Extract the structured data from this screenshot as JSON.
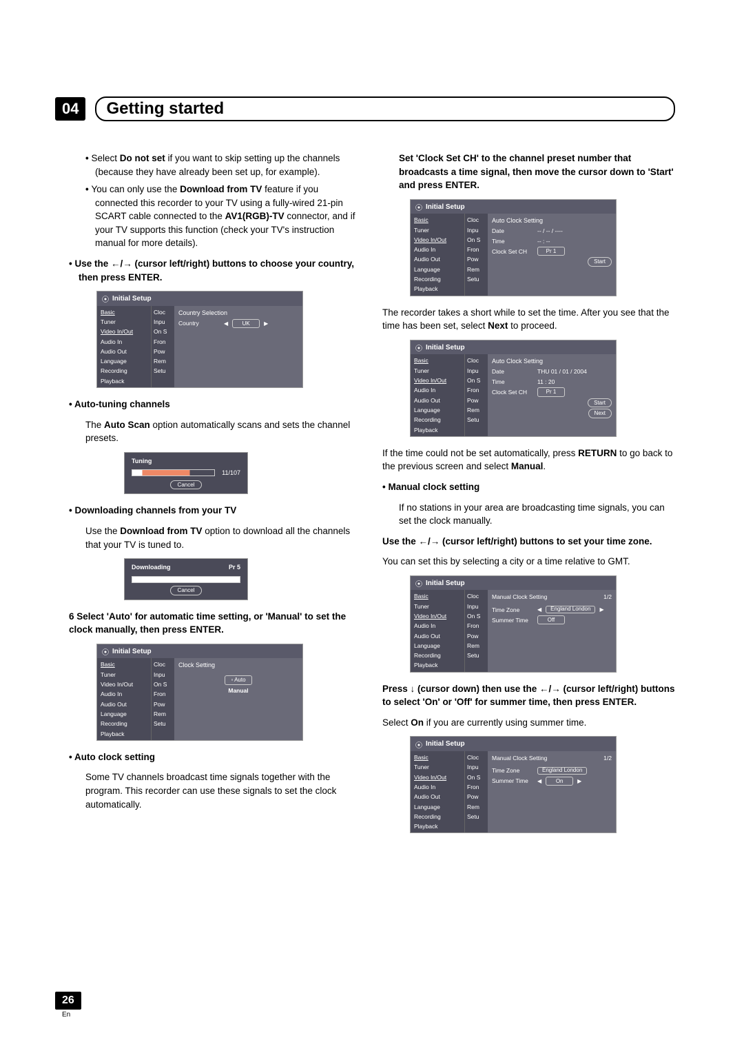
{
  "header": {
    "number": "04",
    "title": "Getting started"
  },
  "footer": {
    "page": "26",
    "lang": "En"
  },
  "osd_common": {
    "title": "Initial Setup",
    "menu": [
      "Basic",
      "Tuner",
      "Video In/Out",
      "Audio In",
      "Audio Out",
      "Language",
      "Recording",
      "Playback"
    ],
    "submenu": [
      "Cloc",
      "Inpu",
      "On S",
      "Fron",
      "Pow",
      "Rem",
      "Setu"
    ]
  },
  "left": {
    "b1a": "Select ",
    "b1b": "Do not set",
    "b1c": " if you want to skip setting up the channels (because they have already been set up, for example).",
    "b2a": "You can only use the ",
    "b2b": "Download from TV",
    "b2c": " feature if you connected this recorder to your TV using a fully-wired 21-pin SCART cable connected to the ",
    "b2d": "AV1(RGB)-TV",
    "b2e": " connector, and if your TV supports this function (check your TV's instruction manual for more details).",
    "step_use": "Use the ←/→ (cursor left/right) buttons to choose your country, then press ENTER.",
    "osd1": {
      "heading": "Country Selection",
      "label": "Country",
      "value": "UK"
    },
    "h_autotune": "Auto-tuning channels",
    "autotune_text_a": "The ",
    "autotune_text_b": "Auto Scan",
    "autotune_text_c": " option automatically scans and sets the channel presets.",
    "osd2": {
      "title": "Tuning",
      "count": "11/107",
      "cancel": "Cancel"
    },
    "h_download": "Downloading channels from your TV",
    "download_text_a": "Use the ",
    "download_text_b": "Download from TV",
    "download_text_c": " option to download all the channels that your TV is tuned to.",
    "osd3": {
      "title": "Downloading",
      "pr": "Pr 5",
      "cancel": "Cancel"
    },
    "step6": "6   Select 'Auto' for automatic time setting, or 'Manual' to set the clock manually, then press ENTER.",
    "osd4": {
      "heading": "Clock Setting",
      "opt1": "Auto",
      "opt2": "Manual"
    },
    "h_autoclock": "Auto clock setting",
    "autoclock_text": "Some TV channels broadcast time signals together with the program. This recorder can use these signals to set the clock automatically."
  },
  "right": {
    "intro": "Set 'Clock Set CH' to the channel preset number that broadcasts a time signal, then move the cursor down to 'Start' and press ENTER.",
    "osd5": {
      "heading": "Auto Clock Setting",
      "date_lbl": "Date",
      "date_val": "-- / -- / ----",
      "time_lbl": "Time",
      "time_val": "-- : --",
      "ch_lbl": "Clock Set CH",
      "ch_val": "Pr 1",
      "start": "Start"
    },
    "after_a": "The recorder takes a short while to set the time. After you see that the time has been set, select ",
    "after_b": "Next",
    "after_c": " to proceed.",
    "osd6": {
      "heading": "Auto Clock Setting",
      "date_lbl": "Date",
      "date_val": "THU  01 / 01 / 2004",
      "time_lbl": "Time",
      "time_val": "11 : 20",
      "ch_lbl": "Clock Set CH",
      "ch_val": "Pr 1",
      "start": "Start",
      "next": "Next"
    },
    "fail_a": "If the time could not be set automatically, press ",
    "fail_b": "RETURN",
    "fail_c": " to go back to the previous screen and select ",
    "fail_d": "Manual",
    "fail_e": ".",
    "h_manual": "Manual clock setting",
    "manual_text": "If no stations in your area are broadcasting time signals, you can set the clock manually.",
    "tz_step": "Use the ←/→ (cursor left/right) buttons to set your time zone.",
    "tz_text": "You can set this by selecting a city or a time relative to GMT.",
    "osd7": {
      "heading": "Manual Clock Setting",
      "page": "1/2",
      "tz_lbl": "Time Zone",
      "tz_val": "England\nLondon",
      "st_lbl": "Summer Time",
      "st_val": "Off"
    },
    "summer_step": "Press ↓ (cursor down) then use the ←/→ (cursor left/right) buttons to select 'On' or 'Off' for summer time, then press ENTER.",
    "summer_text_a": "Select ",
    "summer_text_b": "On",
    "summer_text_c": " if you are currently using summer time.",
    "osd8": {
      "heading": "Manual Clock Setting",
      "page": "1/2",
      "tz_lbl": "Time Zone",
      "tz_val": "England\nLondon",
      "st_lbl": "Summer Time",
      "st_val": "On"
    }
  }
}
